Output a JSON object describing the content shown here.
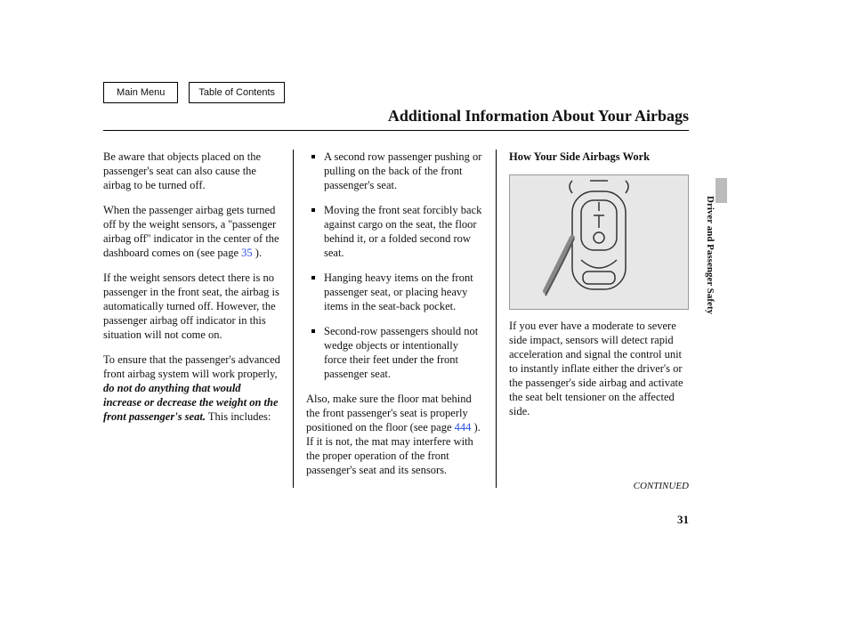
{
  "nav": {
    "main_menu": "Main Menu",
    "toc": "Table of Contents"
  },
  "title": "Additional Information About Your Airbags",
  "col1": {
    "p1": "Be aware that objects placed on the passenger's seat can also cause the airbag to be turned off.",
    "p2a": "When the passenger airbag gets turned off by the weight sensors, a ''passenger airbag off'' indicator in the center of the dashboard comes on (see page ",
    "p2_link": "35",
    "p2b": " ).",
    "p3": "If the weight sensors detect there is no passenger in the front seat, the airbag is automatically turned off. However, the passenger airbag off indicator in this situation will not come on.",
    "p4a": "To ensure that the passenger's advanced front airbag system will work properly, ",
    "p4_emph": "do not do anything that would increase or decrease the weight on the front passenger's seat.",
    "p4b": " This includes:"
  },
  "col2": {
    "li1": "A second row passenger pushing or pulling on the back of the front passenger's seat.",
    "li2": "Moving the front seat forcibly back against cargo on the seat, the floor behind it, or a folded second row seat.",
    "li3": "Hanging heavy items on the front passenger seat, or placing heavy items in the seat-back pocket.",
    "li4": "Second-row passengers should not wedge objects or intentionally force their feet under the front passenger seat.",
    "p5a": "Also, make sure the floor mat behind the front passenger's seat is properly positioned on the floor (see page ",
    "p5_link": "444",
    "p5b": " ). If it is not, the mat may interfere with the proper operation of the front passenger's seat and its sensors."
  },
  "col3": {
    "subhead": "How Your Side Airbags Work",
    "p6": "If you ever have a moderate to severe side impact, sensors will detect rapid acceleration and signal the control unit to instantly inflate either the driver's or the passenger's side airbag and activate the seat belt tensioner on the affected side."
  },
  "side_tab": "Driver and Passenger Safety",
  "continued": "CONTINUED",
  "page_number": "31"
}
